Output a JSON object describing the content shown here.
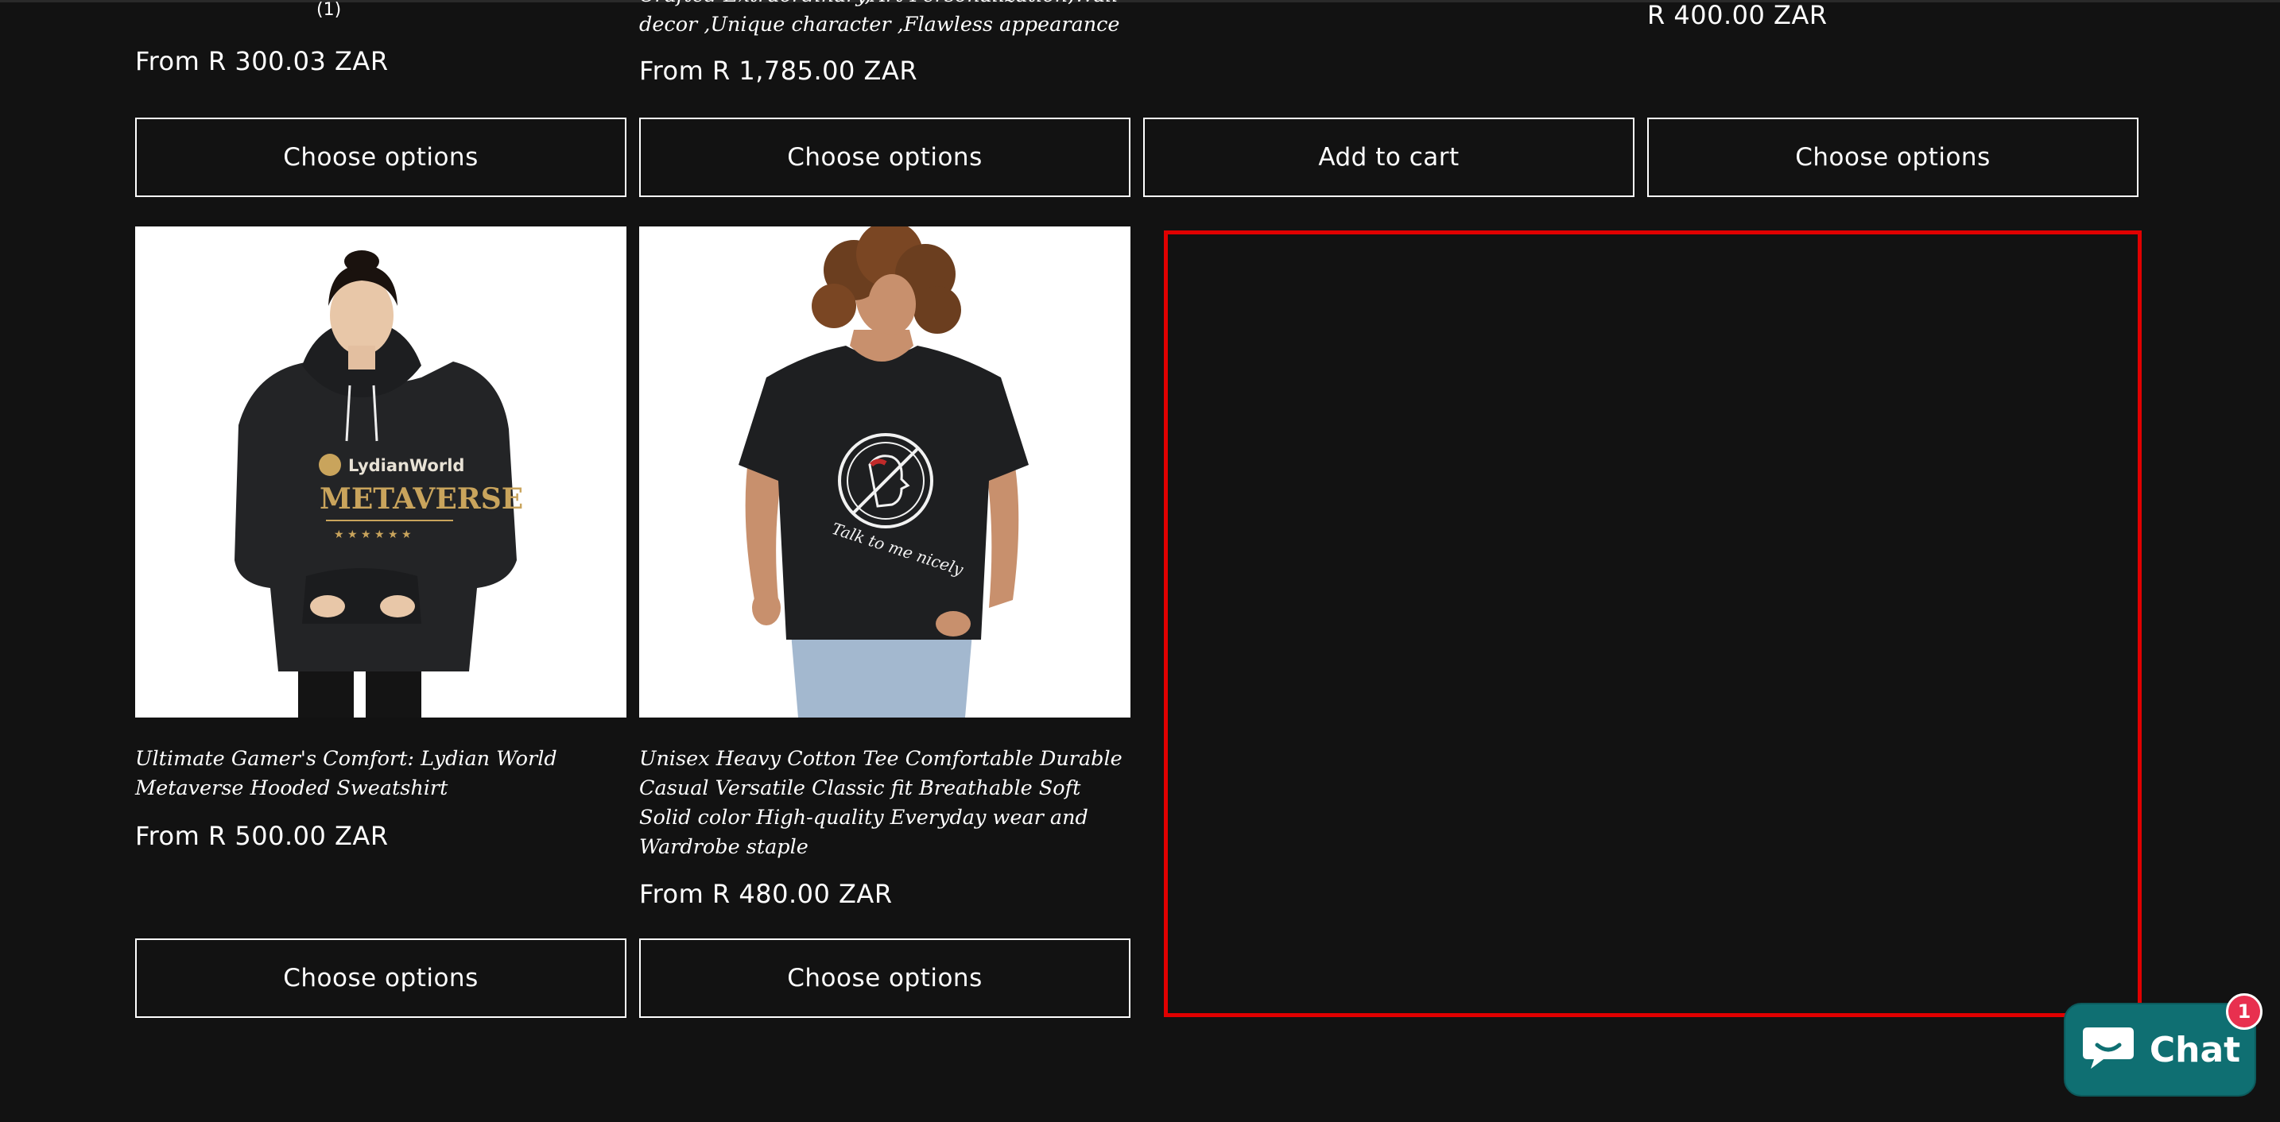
{
  "products_top": [
    {
      "rating_count": "(1)",
      "title_tail": "",
      "price": "From R 300.03 ZAR",
      "button": "Choose options"
    },
    {
      "title_tail": "Crafted Extraordinary,Art Personalization,Wall decor ,Unique character ,Flawless appearance",
      "price": "From R 1,785.00 ZAR",
      "button": "Choose options"
    },
    {
      "price": "",
      "button": "Add to cart"
    },
    {
      "price": "R 400.00 ZAR",
      "button": "Choose options"
    }
  ],
  "products_bottom": [
    {
      "image_alt": "Woman wearing black hoodie with LydianWorld Metaverse print",
      "image_text_brand": "LydianWorld",
      "image_text_main": "METAVERSE",
      "title": "Ultimate Gamer's Comfort: Lydian World Metaverse Hooded Sweatshirt",
      "price": "From R 500.00 ZAR",
      "button": "Choose options"
    },
    {
      "image_alt": "Woman wearing black tee with Talk to me nicely print",
      "image_text": "Talk to me nicely",
      "title": "Unisex Heavy Cotton Tee Comfortable Durable Casual Versatile Classic fit Breathable Soft Solid color High-quality Everyday wear and Wardrobe staple",
      "price": "From R 480.00 ZAR",
      "button": "Choose options"
    }
  ],
  "chat": {
    "label": "Chat",
    "badge": "1"
  },
  "colors": {
    "background": "#121212",
    "highlight": "#e00000",
    "chat_bg": "#0f6f72",
    "badge": "#e8304f"
  }
}
